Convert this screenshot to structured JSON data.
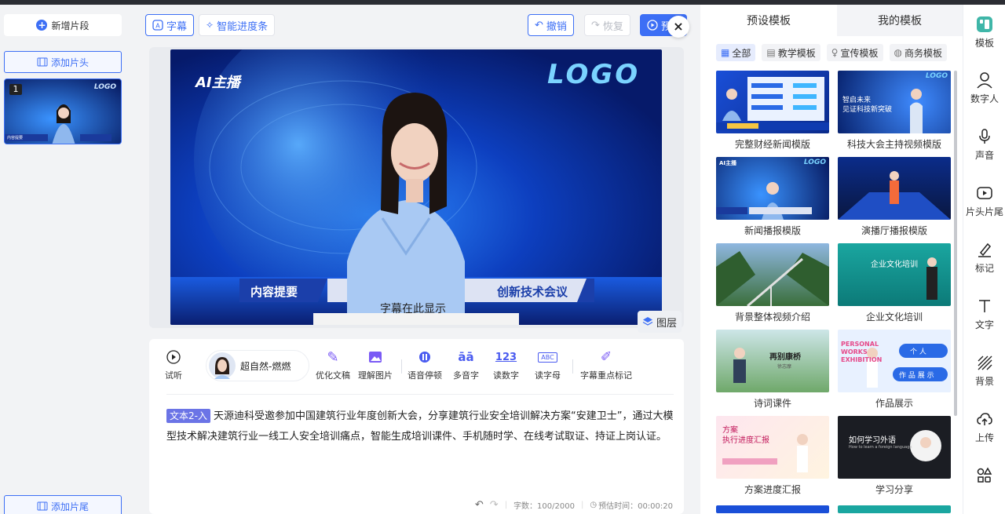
{
  "left": {
    "new_segment": "新增片段",
    "add_head": "添加片头",
    "add_tail": "添加片尾",
    "thumb_number": "1",
    "thumb_logo": "LOGO",
    "thumb_caption": "内容提要"
  },
  "toolbar": {
    "subtitle": "字幕",
    "smart_progress": "智能进度条",
    "undo": "撤销",
    "redo": "恢复",
    "preview": "预"
  },
  "stage": {
    "ai_logo": "AI主播",
    "logo": "LOGO",
    "banner_left": "内容提要",
    "banner_right": "创新技术会议",
    "subtitle_text": "字幕在此显示",
    "layers": "图层"
  },
  "editor": {
    "tools": {
      "listen": "试听",
      "voice_name": "超自然-燃燃",
      "optimize": "优化文稿",
      "understand_image": "理解图片",
      "pause": "语音停顿",
      "polyphone": "多音字",
      "read_number": "读数字",
      "read_letter": "读字母",
      "highlight": "字幕重点标记",
      "polyphone_icon": "āā",
      "number_icon": "123",
      "letter_icon": "ABC"
    },
    "tag": "文本2-入",
    "text": "天源迪科受邀参加中国建筑行业年度创新大会，分享建筑行业安全培训解决方案“安建卫士”，通过大模型技术解决建筑行业一线工人安全培训痛点，智能生成培训课件、手机随时学、在线考试取证、持证上岗认证。",
    "char_count": "字数：100/2000",
    "est_time": "预估时间：00:00:20"
  },
  "templates": {
    "tabs": [
      "预设模板",
      "我的模板"
    ],
    "chips": [
      "全部",
      "教学模板",
      "宣传模板",
      "商务模板"
    ],
    "cards": [
      {
        "name": "完整财经新闻模版",
        "style": "finance"
      },
      {
        "name": "科技大会主持视频模版",
        "style": "tech",
        "overlay": "智启未来\n见证科技新突破",
        "logo": "LOGO"
      },
      {
        "name": "新闻播报模版",
        "style": "news",
        "overlay": "AI主播",
        "logo": "LOGO"
      },
      {
        "name": "演播厅播报模版",
        "style": "studio"
      },
      {
        "name": "背景整体视频介绍",
        "style": "landscape"
      },
      {
        "name": "企业文化培训",
        "style": "culture",
        "overlay": "企业文化培训"
      },
      {
        "name": "诗词课件",
        "style": "poem",
        "overlay": "再别康桥",
        "overlay2": "徐志摩"
      },
      {
        "name": "作品展示",
        "style": "works",
        "overlay": "PERSONAL WORKS EXHIBITION",
        "overlay2": "个 人",
        "overlay3": "作 品 展 示"
      },
      {
        "name": "方案进度汇报",
        "style": "progress",
        "overlay": "方案\n执行进度汇报"
      },
      {
        "name": "学习分享",
        "style": "learn",
        "overlay": "如何学习外语",
        "overlay2": "How to learn a foreign language"
      }
    ]
  },
  "rail": [
    "模板",
    "数字人",
    "声音",
    "片头片尾",
    "标记",
    "文字",
    "背景",
    "上传"
  ],
  "colors": {
    "accent": "#3d6ff5",
    "tag": "#6b74e6"
  }
}
